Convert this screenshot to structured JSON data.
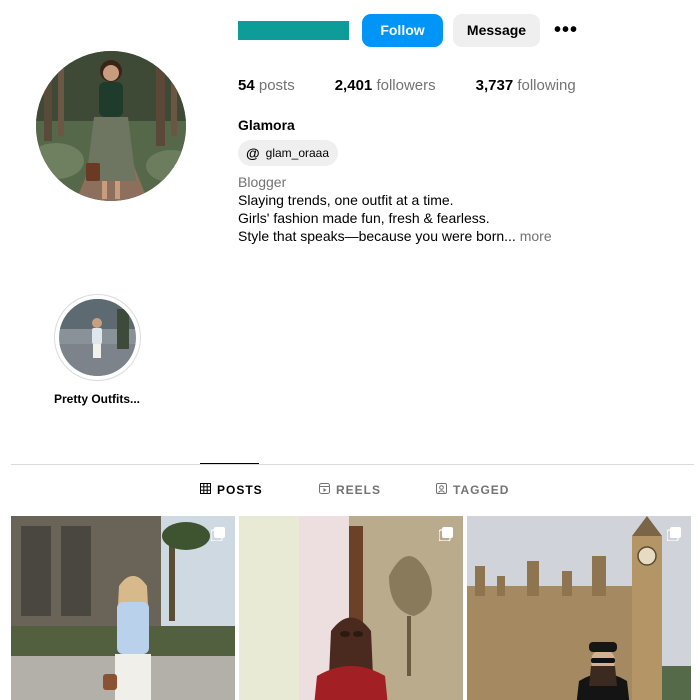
{
  "profile": {
    "follow_label": "Follow",
    "message_label": "Message",
    "more_label": "•••",
    "full_name": "Glamora",
    "threads_handle": "glam_oraaa",
    "category": "Blogger",
    "bio_lines": [
      "Slaying trends, one outfit at a time.",
      "Girls' fashion made fun, fresh & fearless.",
      "Style that speaks—because you were born..."
    ],
    "bio_more": "more",
    "username_color": "#0e9c98"
  },
  "stats": {
    "posts_count": "54",
    "posts_label": "posts",
    "followers_count": "2,401",
    "followers_label": "followers",
    "following_count": "3,737",
    "following_label": "following"
  },
  "highlights": [
    {
      "label": "Pretty Outfits..."
    }
  ],
  "tabs": [
    {
      "label": "POSTS",
      "icon": "grid-icon",
      "active": true
    },
    {
      "label": "REELS",
      "icon": "reels-icon",
      "active": false
    },
    {
      "label": "TAGGED",
      "icon": "tagged-icon",
      "active": false
    }
  ],
  "posts": [
    {
      "icon": "multi-photo-icon"
    },
    {
      "icon": "multi-photo-icon"
    },
    {
      "icon": "multi-photo-icon"
    }
  ],
  "colors": {
    "accent": "#0095f6",
    "muted": "#737373"
  }
}
